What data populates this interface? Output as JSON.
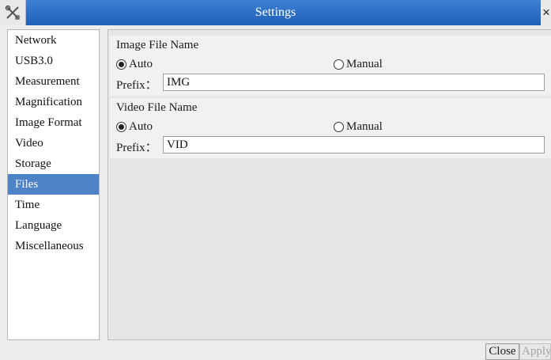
{
  "window": {
    "title": "Settings",
    "app_icon": "tools-icon",
    "close_glyph": "×"
  },
  "sidebar": {
    "items": [
      {
        "label": "Network"
      },
      {
        "label": "USB3.0"
      },
      {
        "label": "Measurement"
      },
      {
        "label": "Magnification"
      },
      {
        "label": "Image Format"
      },
      {
        "label": "Video"
      },
      {
        "label": "Storage"
      },
      {
        "label": "Files"
      },
      {
        "label": "Time"
      },
      {
        "label": "Language"
      },
      {
        "label": "Miscellaneous"
      }
    ],
    "selected": "Files"
  },
  "image_file": {
    "title": "Image File Name",
    "auto_label": "Auto",
    "manual_label": "Manual",
    "selected": "Auto",
    "prefix_label": "Prefix：",
    "prefix_value": "IMG"
  },
  "video_file": {
    "title": "Video File Name",
    "auto_label": "Auto",
    "manual_label": "Manual",
    "selected": "Auto",
    "prefix_label": "Prefix：",
    "prefix_value": "VID"
  },
  "buttons": {
    "close_label": "Close",
    "apply_label": "Apply",
    "apply_enabled": false
  },
  "colors": {
    "titlebar": "#2f6fc6",
    "selection": "#4e83c8"
  }
}
